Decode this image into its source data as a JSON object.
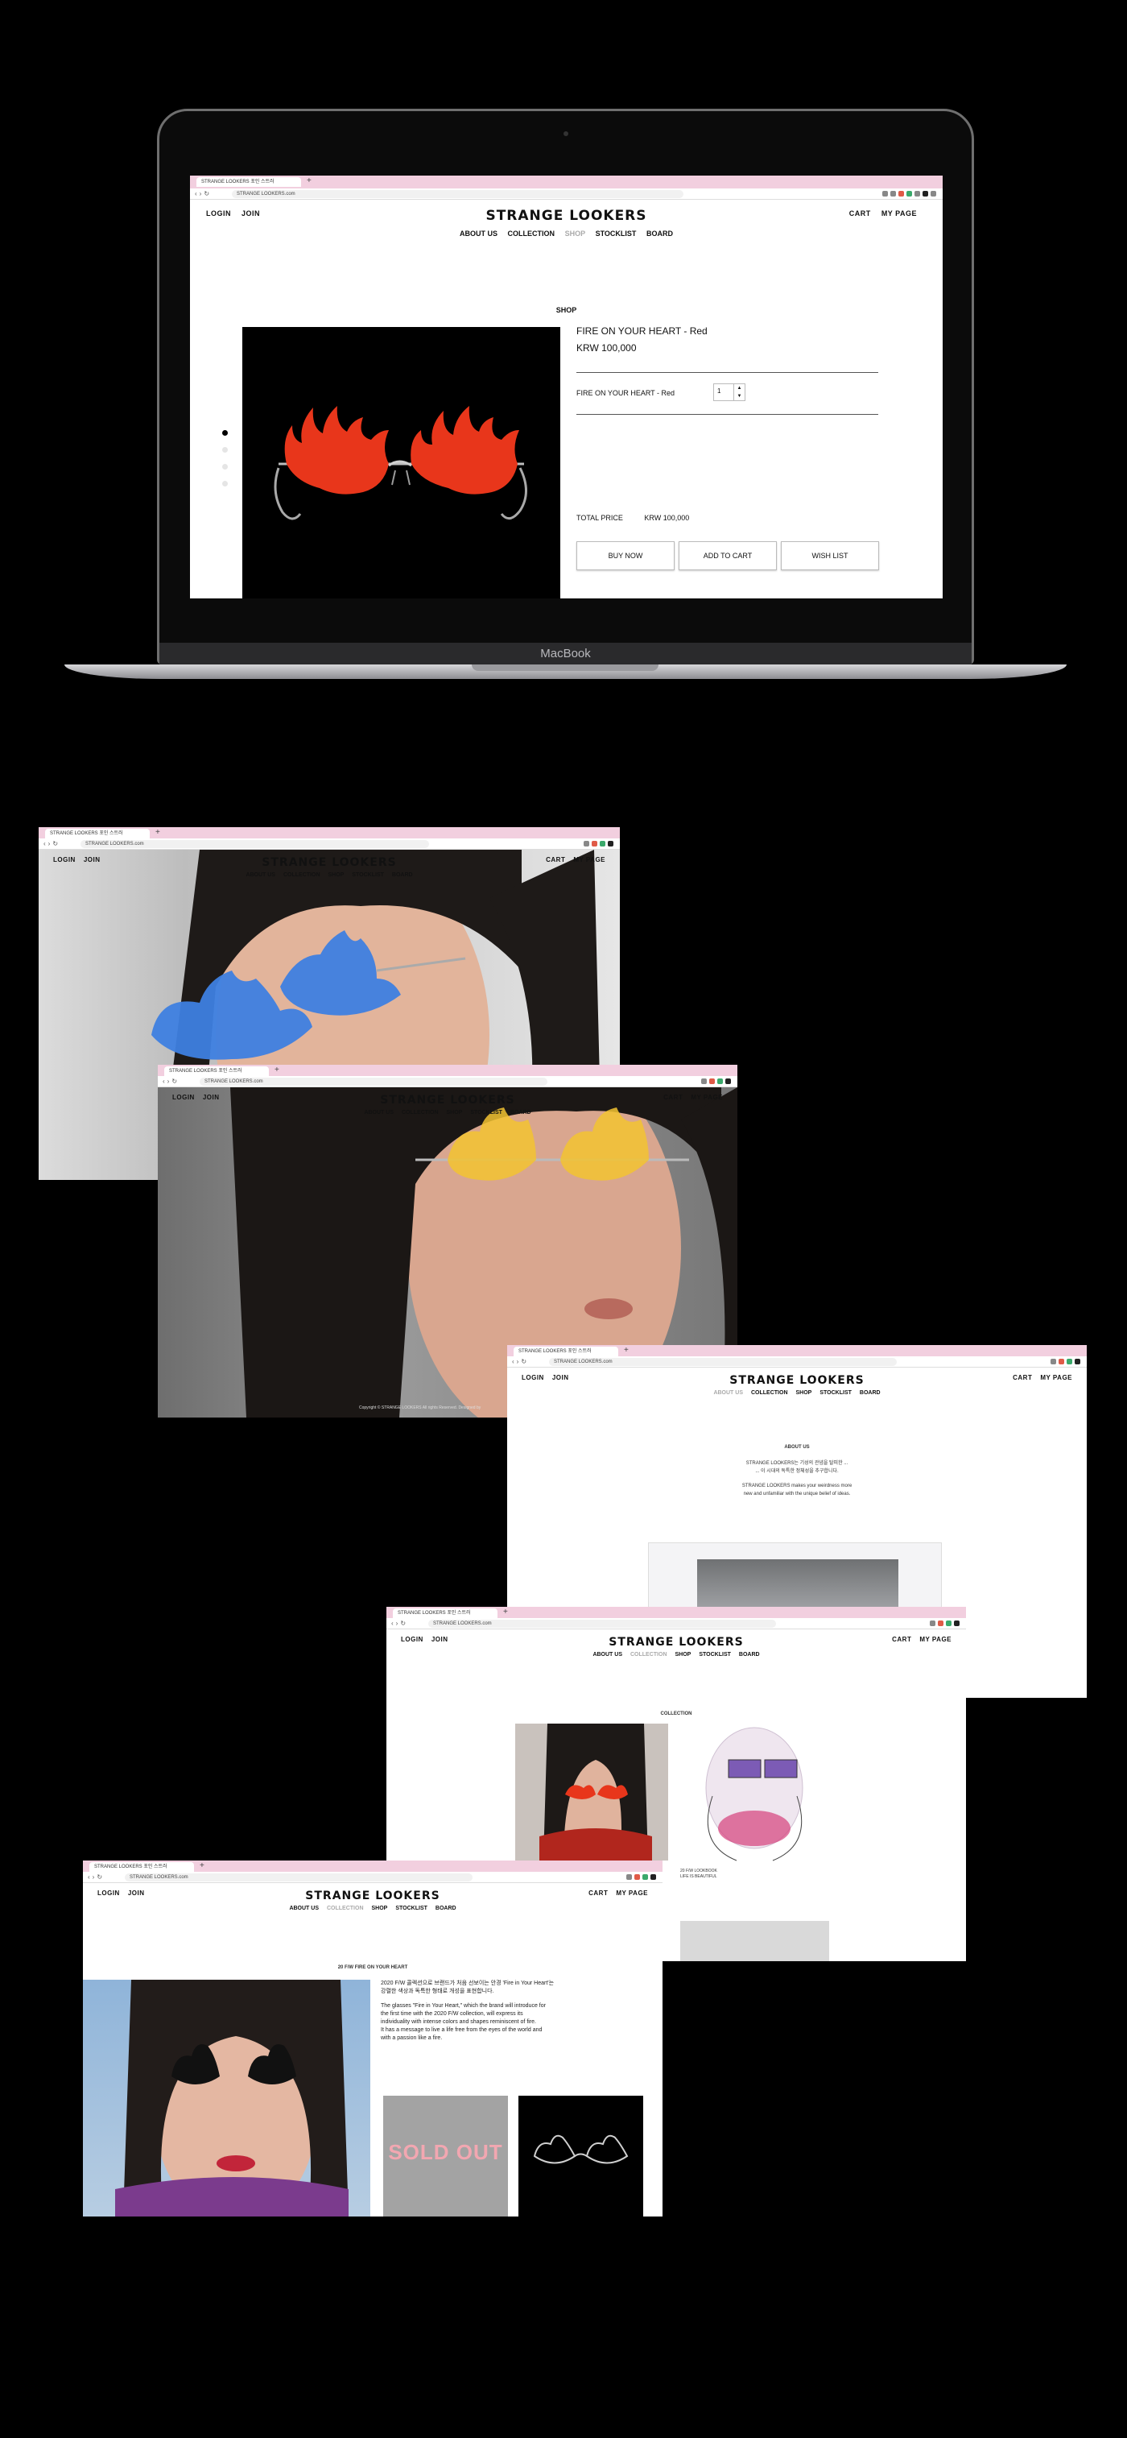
{
  "device": {
    "brand_label": "MacBook"
  },
  "browser": {
    "tab_title": "STRANGE LOOKERS 포인 스트러",
    "url": "STRANGE LOOKERS.com"
  },
  "site": {
    "logo": "STRANGE LOOKERS",
    "login": "LOGIN",
    "join": "JOIN",
    "cart": "CART",
    "my_page": "MY PAGE",
    "nav": [
      "ABOUT US",
      "COLLECTION",
      "SHOP",
      "STOCKLIST",
      "BOARD"
    ]
  },
  "product_page": {
    "section_title": "SHOP",
    "product_name": "FIRE ON YOUR HEART - Red",
    "price": "KRW 100,000",
    "option_label": "FIRE ON YOUR HEART - Red",
    "quantity": "1",
    "total_label": "TOTAL PRICE",
    "total_value": "KRW 100,000",
    "buttons": [
      "BUY NOW",
      "ADD TO CART",
      "WISH LIST"
    ]
  },
  "footer_text": "Copyright © STRANGE LOOKERS All rights Reserved.  Designed by",
  "about_page": {
    "title": "ABOUT US",
    "lines_ko": [
      "STRANGE LOOKERS는 기성의 관념을 탈피한 ...",
      "... 이 시대의 독특한 정체성을 추구합니다."
    ],
    "lines_en": [
      "STRANGE LOOKERS makes your weirdness more",
      "new and unfamiliar with the unique belief of ideas."
    ]
  },
  "collection_page": {
    "title": "COLLECTION",
    "caption": [
      "20 F/W LOOKBOOK",
      "LIFE IS BEAUTIFUL"
    ]
  },
  "lookbook_page": {
    "title": "20 F/W FIRE ON YOUR HEART",
    "ko_text": [
      "2020 F/W 콜렉션으로 브랜드가 처음 선보이는 안경 'Fire in Your Heart'는",
      "강렬한 색상과 독특한 형태로 개성을 표현합니다."
    ],
    "en_text": [
      "The glasses \"Fire in Your Heart,\" which the brand will introduce for",
      "the first time with the 2020 F/W collection, will express its",
      "individuality with intense colors and shapes reminiscent of fire.",
      "It has a message to live a life free from the eyes of the world and",
      "with a passion like a fire."
    ],
    "sold_out": "SOLD OUT"
  },
  "colors": {
    "background": "#000000",
    "tab_bar": "#f2cfdf",
    "flame_red": "#e8361b",
    "flame_blue": "#3e7fe0",
    "flame_yellow": "#f2c331"
  }
}
